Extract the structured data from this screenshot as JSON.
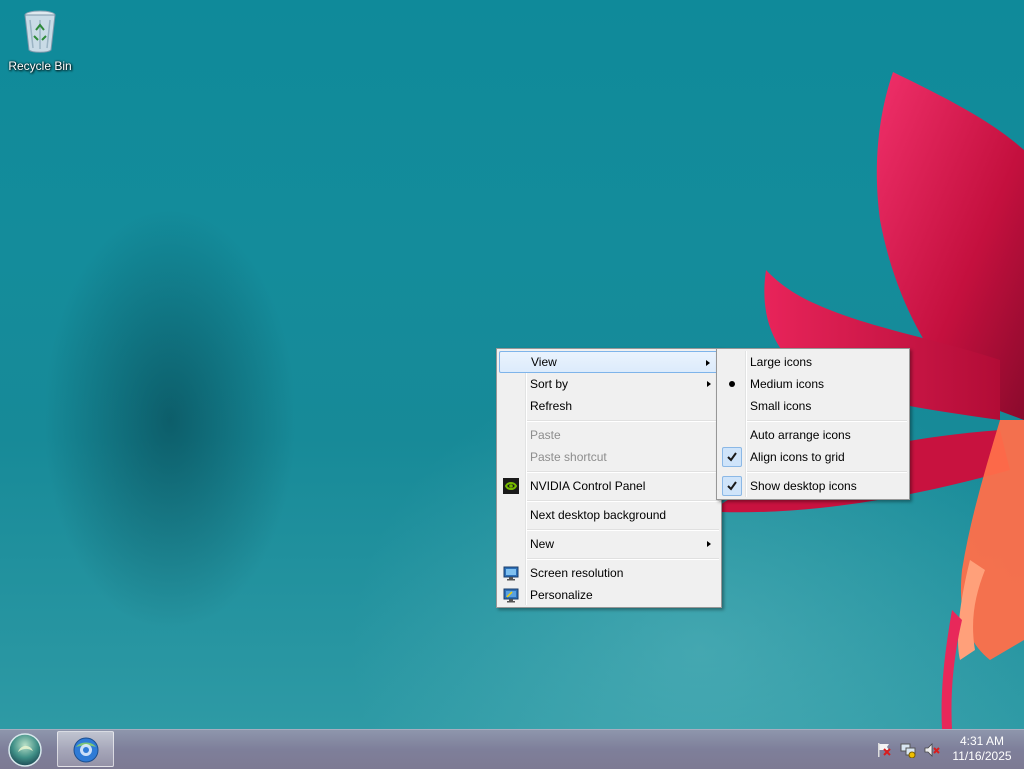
{
  "desktop": {
    "icons": [
      {
        "label": "Recycle Bin",
        "icon": "recycle-bin-icon"
      }
    ]
  },
  "context_menu": {
    "items": [
      {
        "label": "View",
        "submenu": true,
        "highlighted": true
      },
      {
        "label": "Sort by",
        "submenu": true
      },
      {
        "label": "Refresh"
      },
      {
        "label": "Paste",
        "disabled": true
      },
      {
        "label": "Paste shortcut",
        "disabled": true
      },
      {
        "label": "NVIDIA Control Panel",
        "icon": "nvidia-icon"
      },
      {
        "label": "Next desktop background"
      },
      {
        "label": "New",
        "submenu": true
      },
      {
        "label": "Screen resolution",
        "icon": "screen-resolution-icon"
      },
      {
        "label": "Personalize",
        "icon": "personalize-icon"
      }
    ]
  },
  "view_submenu": {
    "items": [
      {
        "label": "Large icons"
      },
      {
        "label": "Medium icons",
        "state": "selected-radio"
      },
      {
        "label": "Small icons"
      },
      {
        "label": "Auto arrange icons"
      },
      {
        "label": "Align icons to grid",
        "state": "checked"
      },
      {
        "label": "Show desktop icons",
        "state": "checked"
      }
    ]
  },
  "taskbar": {
    "start_icon": "start-orb-icon",
    "pinned_app_icon": "app-globe-icon",
    "tray_icons": [
      "action-center-flag-icon",
      "network-icon",
      "volume-muted-icon"
    ]
  },
  "clock": {
    "time": "4:31 AM",
    "date": "11/16/2025"
  },
  "colors": {
    "menu_background": "#f0f0f0",
    "menu_highlight": "#dcebfc",
    "menu_highlight_border": "#7eb4ea",
    "taskbar": "#7e7f9a",
    "desktop_teal": "#148c9b"
  }
}
